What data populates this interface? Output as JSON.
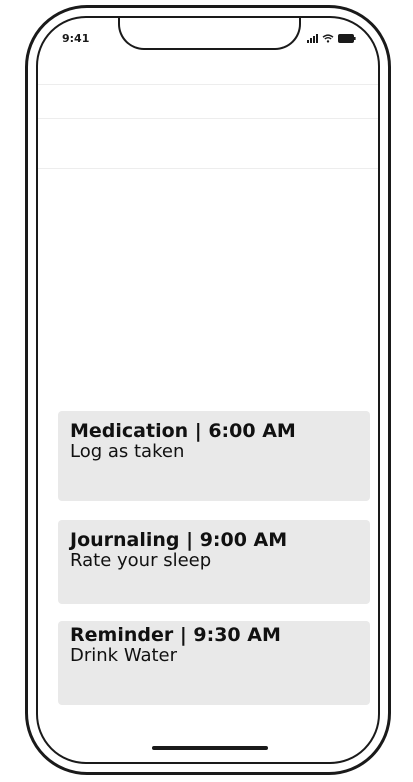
{
  "status_bar": {
    "time": "9:41",
    "icons": [
      "signal-icon",
      "wifi-icon",
      "battery-icon"
    ]
  },
  "cards": [
    {
      "title": "Medication | 6:00 AM",
      "subtitle": "Log as taken"
    },
    {
      "title": "Journaling | 9:00 AM",
      "subtitle": "Rate your sleep"
    },
    {
      "title": "Reminder | 9:30 AM",
      "subtitle": "Drink Water"
    }
  ],
  "colors": {
    "frame": "#1a1a1a",
    "card_background": "#e9e9e9",
    "text": "#111111"
  }
}
